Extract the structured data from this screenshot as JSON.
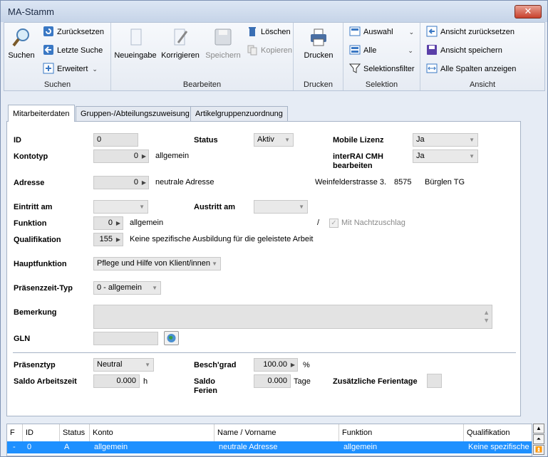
{
  "window": {
    "title": "MA-Stamm",
    "close": "✕"
  },
  "ribbon": {
    "suchen": {
      "label": "Suchen",
      "group": "Suchen",
      "zuruecksetzen": "Zurücksetzen",
      "letzte_suche": "Letzte Suche",
      "erweitert": "Erweitert"
    },
    "bearbeiten": {
      "group": "Bearbeiten",
      "neueingabe": "Neueingabe",
      "korrigieren": "Korrigieren",
      "speichern": "Speichern",
      "loeschen": "Löschen",
      "kopieren": "Kopieren"
    },
    "drucken": {
      "group": "Drucken",
      "label": "Drucken"
    },
    "selektion": {
      "group": "Selektion",
      "auswahl": "Auswahl",
      "alle": "Alle",
      "selektionsfilter": "Selektionsfilter"
    },
    "ansicht": {
      "group": "Ansicht",
      "zuruecksetzen": "Ansicht zurücksetzen",
      "speichern": "Ansicht speichern",
      "alle_spalten": "Alle Spalten anzeigen"
    }
  },
  "tabs": [
    "Mitarbeiterdaten",
    "Gruppen-/Abteilungszuweisung",
    "Artikelgruppenzuordnung"
  ],
  "form": {
    "id_label": "ID",
    "id_value": "0",
    "status_label": "Status",
    "status_value": "Aktiv",
    "mobile_label": "Mobile Lizenz",
    "mobile_value": "Ja",
    "kontotyp_label": "Kontotyp",
    "kontotyp_num": "0",
    "kontotyp_text": "allgemein",
    "interrai_label": "interRAI CMH bearbeiten",
    "interrai_value": "Ja",
    "adresse_label": "Adresse",
    "adresse_num": "0",
    "adresse_text": "neutrale Adresse",
    "adresse_empty": "",
    "strasse": "Weinfelderstrasse 3.",
    "plz": "8575",
    "ort": "Bürglen TG",
    "eintritt_label": "Eintritt am",
    "austritt_label": "Austritt am",
    "funktion_label": "Funktion",
    "funktion_num": "0",
    "funktion_text": "allgemein",
    "slash": "/",
    "nachtzuschlag": "Mit Nachtzuschlag",
    "qualifikation_label": "Qualifikation",
    "qualifikation_num": "155",
    "qualifikation_text": "Keine spezifische Ausbildung für die geleistete Arbeit",
    "hauptfunktion_label": "Hauptfunktion",
    "hauptfunktion_value": "Pflege und Hilfe von Klient/innen",
    "praesenzzeit_label": "Präsenzzeit-Typ",
    "praesenzzeit_value": "0 - allgemein",
    "bemerkung_label": "Bemerkung",
    "gln_label": "GLN",
    "praesenztyp_label": "Präsenztyp",
    "praesenztyp_value": "Neutral",
    "beschgrad_label": "Besch'grad",
    "beschgrad_value": "100.00",
    "percent": "%",
    "saldo_arbeitszeit_label": "Saldo Arbeitszeit",
    "saldo_arbeitszeit_value": "0.000",
    "unit_h": "h",
    "saldo_ferien_label": "Saldo Ferien",
    "saldo_ferien_value": "0.000",
    "unit_tage": "Tage",
    "zusatz_label": "Zusätzliche Ferientage"
  },
  "grid": {
    "headers": [
      "F",
      "ID",
      "Status",
      "Konto",
      "Name / Vorname",
      "Funktion",
      "Qualifikation"
    ],
    "row": [
      "-",
      "0",
      "A",
      "allgemein",
      "neutrale Adresse",
      "allgemein",
      "Keine spezifische"
    ]
  }
}
